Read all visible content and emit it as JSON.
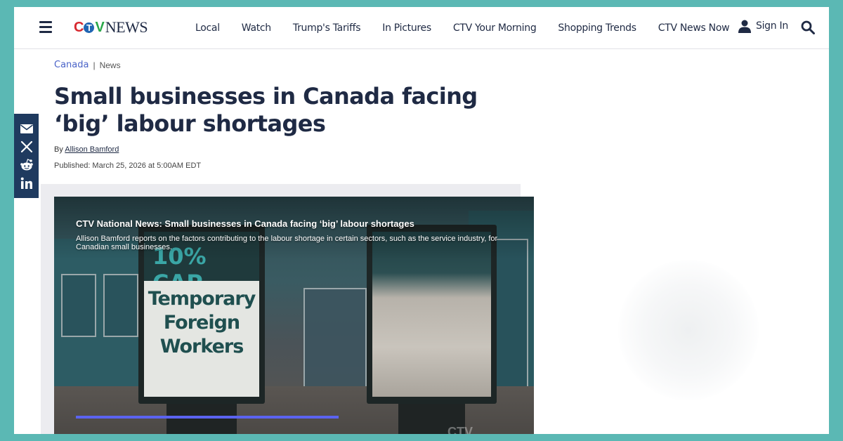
{
  "header": {
    "logo": {
      "part1": "C",
      "part2": "T",
      "part3": "V",
      "part4": "NEWS"
    },
    "nav": [
      "Local",
      "Watch",
      "Trump's Tariffs",
      "In Pictures",
      "CTV Your Morning",
      "Shopping Trends",
      "CTV News Now"
    ],
    "sign_in": "Sign In"
  },
  "breadcrumb": {
    "section": "Canada",
    "separator": "|",
    "subsection": "News"
  },
  "article": {
    "title": "Small businesses in Canada facing ‘big’ labour shortages",
    "byline_prefix": "By",
    "author": "Allison Bamford",
    "published": "Published: March 25, 2026 at 5:00AM EDT"
  },
  "video": {
    "title": "CTV National News: Small businesses in Canada facing ‘big’ labour shortages",
    "description": "Allison Bamford reports on the factors contributing to the labour shortage in certain sectors, such as the service industry, for Canadian small businesses.",
    "sign_line1": "10% CAP",
    "sign_line2": "Temporary",
    "sign_line3": "Foreign",
    "sign_line4": "Workers",
    "watermark": "CTV",
    "progress": 0.55
  },
  "share": [
    "email-icon",
    "x-icon",
    "reddit-icon",
    "linkedin-icon"
  ],
  "colors": {
    "accent": "#4a63c8",
    "navy": "#1f2a44",
    "share_rail": "#1f3a5f",
    "progress": "#5b63f0",
    "outer_bg": "#5bb8b4"
  }
}
